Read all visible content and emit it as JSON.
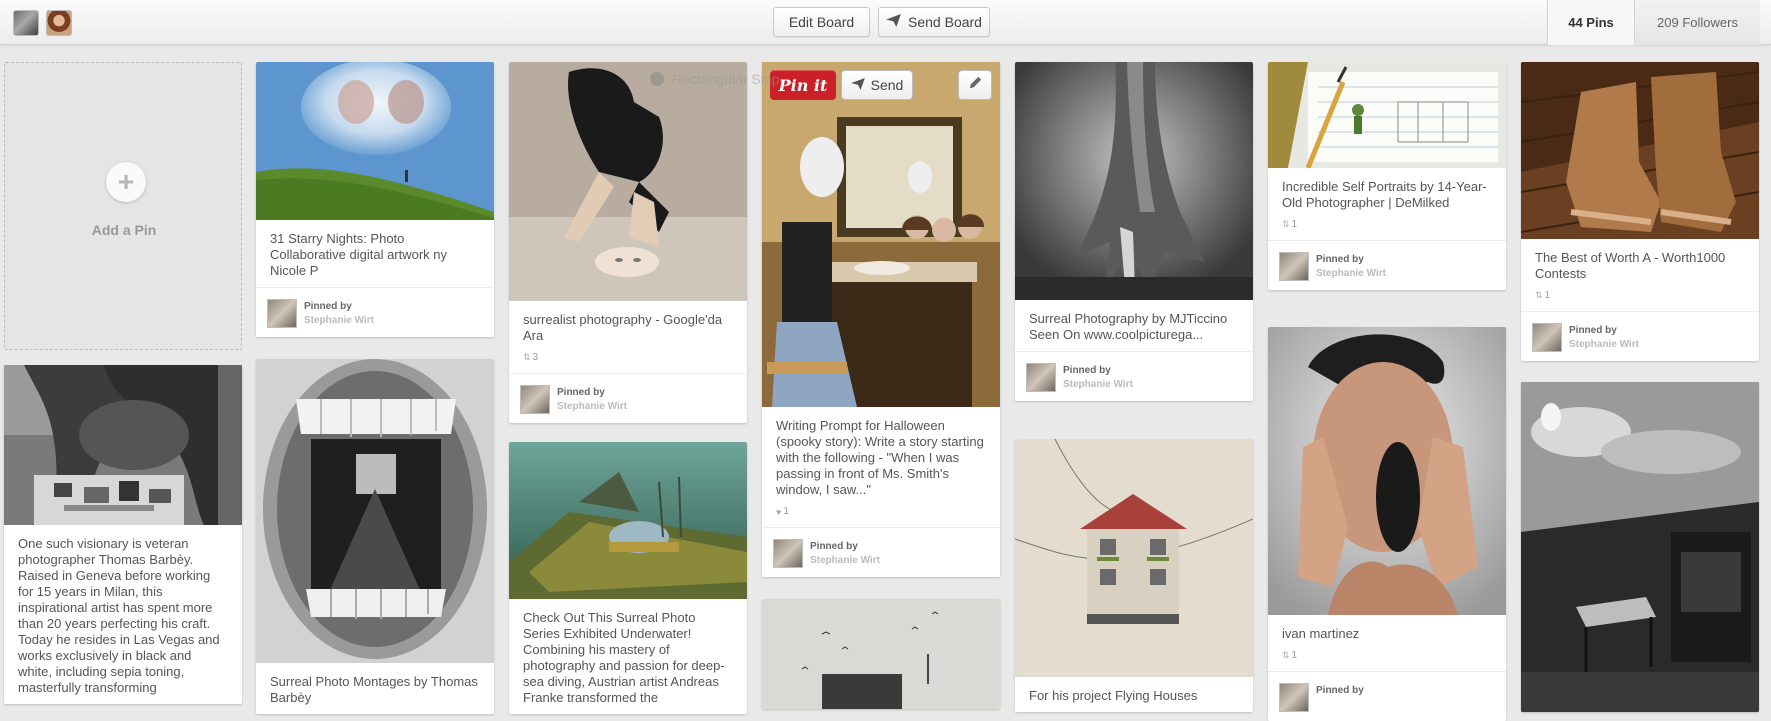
{
  "header": {
    "edit_board": "Edit Board",
    "send_board": "Send Board",
    "pins": "44 Pins",
    "followers": "209 Followers"
  },
  "add_pin": {
    "label": "Add a Pin"
  },
  "overlay": {
    "pinit": "Pin it",
    "send": "Send",
    "snip": "Rectangular Snip"
  },
  "pinned_by": {
    "label": "Pinned by",
    "name": "Stephanie Wirt"
  },
  "pins": [
    {
      "desc": "31 Starry Nights: Photo Collaborative digital artwork ny Nicole P"
    },
    {
      "desc": "surrealist photography - Google'da Ara",
      "repins": "3"
    },
    {
      "desc": "Writing Prompt for Halloween (spooky story): Write a story starting with the following - \"When I was passing in front of Ms. Smith's window, I saw...\"",
      "likes": "1"
    },
    {
      "desc": "Surreal Photography by MJTiccino Seen On www.coolpicturega..."
    },
    {
      "desc": "Incredible Self Portraits by 14-Year-Old Photographer | DeMilked",
      "repins": "1"
    },
    {
      "desc": "The Best of Worth A - Worth1000 Contests",
      "repins": "1"
    },
    {
      "desc": "One such visionary is veteran photographer Thomas Barbèy. Raised in Geneva before working for 15 years in Milan, this inspirational artist has spent more than 20 years perfecting his craft. Today he resides in Las Vegas and works exclusively in black and white, including sepia toning, masterfully transforming"
    },
    {
      "desc": "Surreal Photo Montages by Thomas Barbèy"
    },
    {
      "desc": "Check Out This Surreal Photo Series Exhibited Underwater! Combining his mastery of photography and passion for deep-sea diving, Austrian artist Andreas Franke transformed the"
    },
    {
      "desc": "For his project Flying Houses"
    },
    {
      "desc": "ivan martinez",
      "repins": "1"
    }
  ],
  "colors": {
    "pinit_red": "#cb2027",
    "background": "#e9e9e9"
  }
}
